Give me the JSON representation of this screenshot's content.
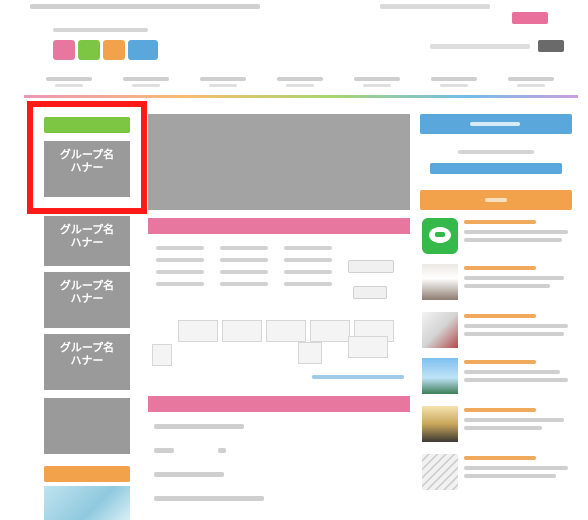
{
  "group_card": {
    "title": "グループ名 / ハナー",
    "title_line1": "グループ名",
    "title_line2": "ハナー"
  },
  "group_cards": [
    {
      "line1": "グループ名",
      "line2": "ハナー"
    },
    {
      "line1": "グループ名",
      "line2": "ハナー"
    },
    {
      "line1": "グループ名",
      "line2": "ハナー"
    },
    {
      "line1": "グループ名",
      "line2": "ハナー"
    }
  ],
  "colors": {
    "highlight": "#ff1a1a",
    "green_tab": "#7cc644",
    "pink_section": "#e8779f",
    "blue_button": "#5aa7dc",
    "orange_button": "#f2a24a",
    "card_gray": "#9a9a9a"
  },
  "icons": {
    "line": "chat-bubble-icon"
  }
}
